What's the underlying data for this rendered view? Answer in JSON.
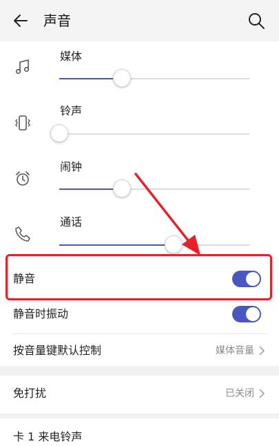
{
  "header": {
    "title": "声音",
    "back_icon": "back-arrow-icon",
    "search_icon": "search-icon"
  },
  "volumes": [
    {
      "label": "媒体",
      "icon": "music-note-icon",
      "level": 0.33
    },
    {
      "label": "铃声",
      "icon": "vibrate-icon",
      "level": 0.0
    },
    {
      "label": "闹钟",
      "icon": "alarm-clock-icon",
      "level": 0.33
    },
    {
      "label": "通话",
      "icon": "phone-icon",
      "level": 0.6
    }
  ],
  "toggles": [
    {
      "label": "静音",
      "on": true
    },
    {
      "label": "静音时振动",
      "on": true
    }
  ],
  "volume_key": {
    "label": "按音量键默认控制",
    "value": "媒体音量"
  },
  "dnd": {
    "label": "免打扰",
    "value": "已关闭"
  },
  "ringtone": {
    "label": "卡 1 来电铃声"
  },
  "colors": {
    "accent": "#4a56c2",
    "annotation": "#e8202a",
    "background": "#f2f2f2"
  }
}
